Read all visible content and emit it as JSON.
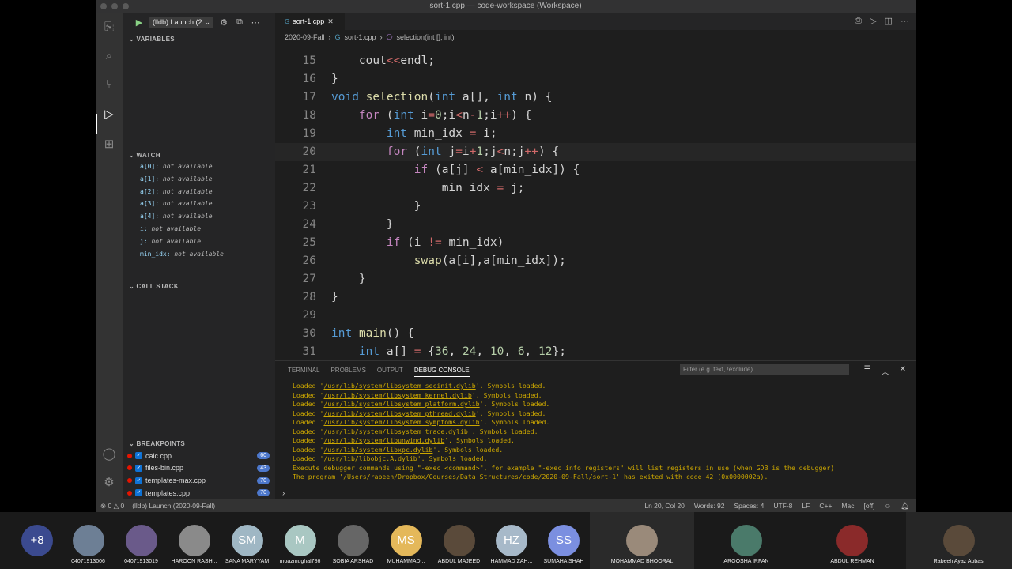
{
  "window": {
    "title": "sort-1.cpp — code-workspace (Workspace)"
  },
  "debug": {
    "launch_label": "(lldb) Launch (2"
  },
  "sidebar": {
    "variables_header": "VARIABLES",
    "watch_header": "WATCH",
    "watch": [
      {
        "name": "a[0]:",
        "value": "not available"
      },
      {
        "name": "a[1]:",
        "value": "not available"
      },
      {
        "name": "a[2]:",
        "value": "not available"
      },
      {
        "name": "a[3]:",
        "value": "not available"
      },
      {
        "name": "a[4]:",
        "value": "not available"
      },
      {
        "name": "i:",
        "value": "not available"
      },
      {
        "name": "j:",
        "value": "not available"
      },
      {
        "name": "min_idx:",
        "value": "not available"
      }
    ],
    "callstack_header": "CALL STACK",
    "breakpoints_header": "BREAKPOINTS",
    "breakpoints": [
      {
        "file": "calc.cpp",
        "count": "60"
      },
      {
        "file": "files-bin.cpp",
        "count": "43"
      },
      {
        "file": "templates-max.cpp",
        "count": "70"
      },
      {
        "file": "templates.cpp",
        "count": "70"
      }
    ]
  },
  "editor": {
    "tab": "sort-1.cpp",
    "breadcrumb": [
      "2020-09-Fall",
      "sort-1.cpp",
      "selection(int [], int)"
    ],
    "lines": [
      {
        "n": "15",
        "t": "    cout<<endl;"
      },
      {
        "n": "16",
        "t": "}"
      },
      {
        "n": "17",
        "t": "void selection(int a[], int n) {"
      },
      {
        "n": "18",
        "t": "    for (int i=0;i<n-1;i++) {"
      },
      {
        "n": "19",
        "t": "        int min_idx = i;"
      },
      {
        "n": "20",
        "t": "        for (int j=i+1;j<n;j++) {"
      },
      {
        "n": "21",
        "t": "            if (a[j] < a[min_idx]) {"
      },
      {
        "n": "22",
        "t": "                min_idx = j;"
      },
      {
        "n": "23",
        "t": "            }"
      },
      {
        "n": "24",
        "t": "        }"
      },
      {
        "n": "25",
        "t": "        if (i != min_idx)"
      },
      {
        "n": "26",
        "t": "            swap(a[i],a[min_idx]);"
      },
      {
        "n": "27",
        "t": "    }"
      },
      {
        "n": "28",
        "t": "}"
      },
      {
        "n": "29",
        "t": ""
      },
      {
        "n": "30",
        "t": "int main() {"
      },
      {
        "n": "31",
        "t": "    int a[] = {36, 24, 10, 6, 12};"
      }
    ]
  },
  "panel": {
    "tabs": [
      "TERMINAL",
      "PROBLEMS",
      "OUTPUT",
      "DEBUG CONSOLE"
    ],
    "filter_placeholder": "Filter (e.g. text, !exclude)",
    "console": [
      [
        "Loaded '",
        "/usr/lib/system/libsystem_secinit.dylib",
        "'. Symbols loaded."
      ],
      [
        "Loaded '",
        "/usr/lib/system/libsystem_kernel.dylib",
        "'. Symbols loaded."
      ],
      [
        "Loaded '",
        "/usr/lib/system/libsystem_platform.dylib",
        "'. Symbols loaded."
      ],
      [
        "Loaded '",
        "/usr/lib/system/libsystem_pthread.dylib",
        "'. Symbols loaded."
      ],
      [
        "Loaded '",
        "/usr/lib/system/libsystem_symptoms.dylib",
        "'. Symbols loaded."
      ],
      [
        "Loaded '",
        "/usr/lib/system/libsystem_trace.dylib",
        "'. Symbols loaded."
      ],
      [
        "Loaded '",
        "/usr/lib/system/libunwind.dylib",
        "'. Symbols loaded."
      ],
      [
        "Loaded '",
        "/usr/lib/system/libxpc.dylib",
        "'. Symbols loaded."
      ],
      [
        "Loaded '",
        "/usr/lib/libobjc.A.dylib",
        "'. Symbols loaded."
      ],
      [
        "Execute debugger commands using \"-exec <command>\", for example \"-exec info registers\" will list registers in use (when GDB is the debugger)",
        "",
        ""
      ],
      [
        "The program '/Users/rabeeh/Dropbox/Courses/Data Structures/code/2020-09-Fall/sort-1' has exited with code 42 (0x0000002a).",
        "",
        ""
      ]
    ]
  },
  "status": {
    "errors": "⊗ 0 △ 0",
    "launch": "(lldb) Launch (2020-09-Fall)",
    "position": "Ln 20, Col 20",
    "words": "Words: 92",
    "spaces": "Spaces: 4",
    "encoding": "UTF-8",
    "eol": "LF",
    "language": "C++",
    "platform": "Mac",
    "off": "[off]"
  },
  "participants": [
    {
      "label": "+8",
      "name": "",
      "color": "#3b4a8f"
    },
    {
      "label": "",
      "name": "04071913006",
      "color": "#6d7f95"
    },
    {
      "label": "",
      "name": "04071913019",
      "color": "#6a5a8a"
    },
    {
      "label": "",
      "name": "HAROON RASH...",
      "color": "#8a8a8a"
    },
    {
      "label": "SM",
      "name": "SANA MARYYAM",
      "color": "#9fb7c4"
    },
    {
      "label": "M",
      "name": "moazmughal786",
      "color": "#a9c7c2"
    },
    {
      "label": "",
      "name": "SOBIA ARSHAD",
      "color": "#666"
    },
    {
      "label": "MS",
      "name": "MUHAMMAD...",
      "color": "#e4b85a"
    },
    {
      "label": "",
      "name": "ABDUL MAJEED",
      "color": "#5a4a3a"
    },
    {
      "label": "HZ",
      "name": "HAMMAD ZAH...",
      "color": "#a7b9c9"
    },
    {
      "label": "SS",
      "name": "SUMAHA SHAH",
      "color": "#7b8fe0"
    },
    {
      "label": "",
      "name": "MOHAMMAD BHOORAL",
      "color": "#9a8a7a"
    },
    {
      "label": "",
      "name": "AROOSHA IRFAN",
      "color": "#4a7a6a"
    },
    {
      "label": "",
      "name": "ABDUL REHMAN",
      "color": "#8a2a2a"
    },
    {
      "label": "",
      "name": "Rabeeh Ayaz Abbasi",
      "color": "#5a4a3a"
    }
  ]
}
